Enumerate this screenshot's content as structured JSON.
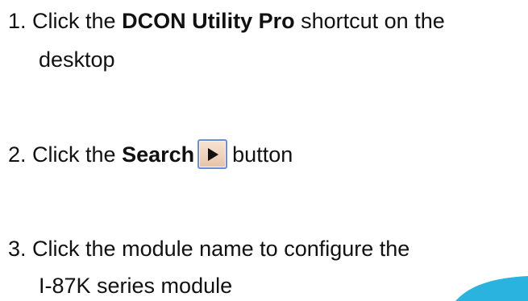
{
  "steps": [
    {
      "number": "1.",
      "before": "Click the",
      "bold": "DCON Utility Pro",
      "after": "shortcut on the",
      "continuation": "desktop"
    },
    {
      "number": "2.",
      "before": "Click the",
      "bold": "Search",
      "after": "button",
      "button_icon": "play-triangle-icon"
    },
    {
      "number": "3.",
      "text": "Click the module name to configure the",
      "continuation": "I-87K series module"
    }
  ],
  "colors": {
    "text": "#111111",
    "button_fill": "#efd2bb",
    "button_border": "#6b8fd6",
    "decor_cyan": "#2bb3e0"
  }
}
